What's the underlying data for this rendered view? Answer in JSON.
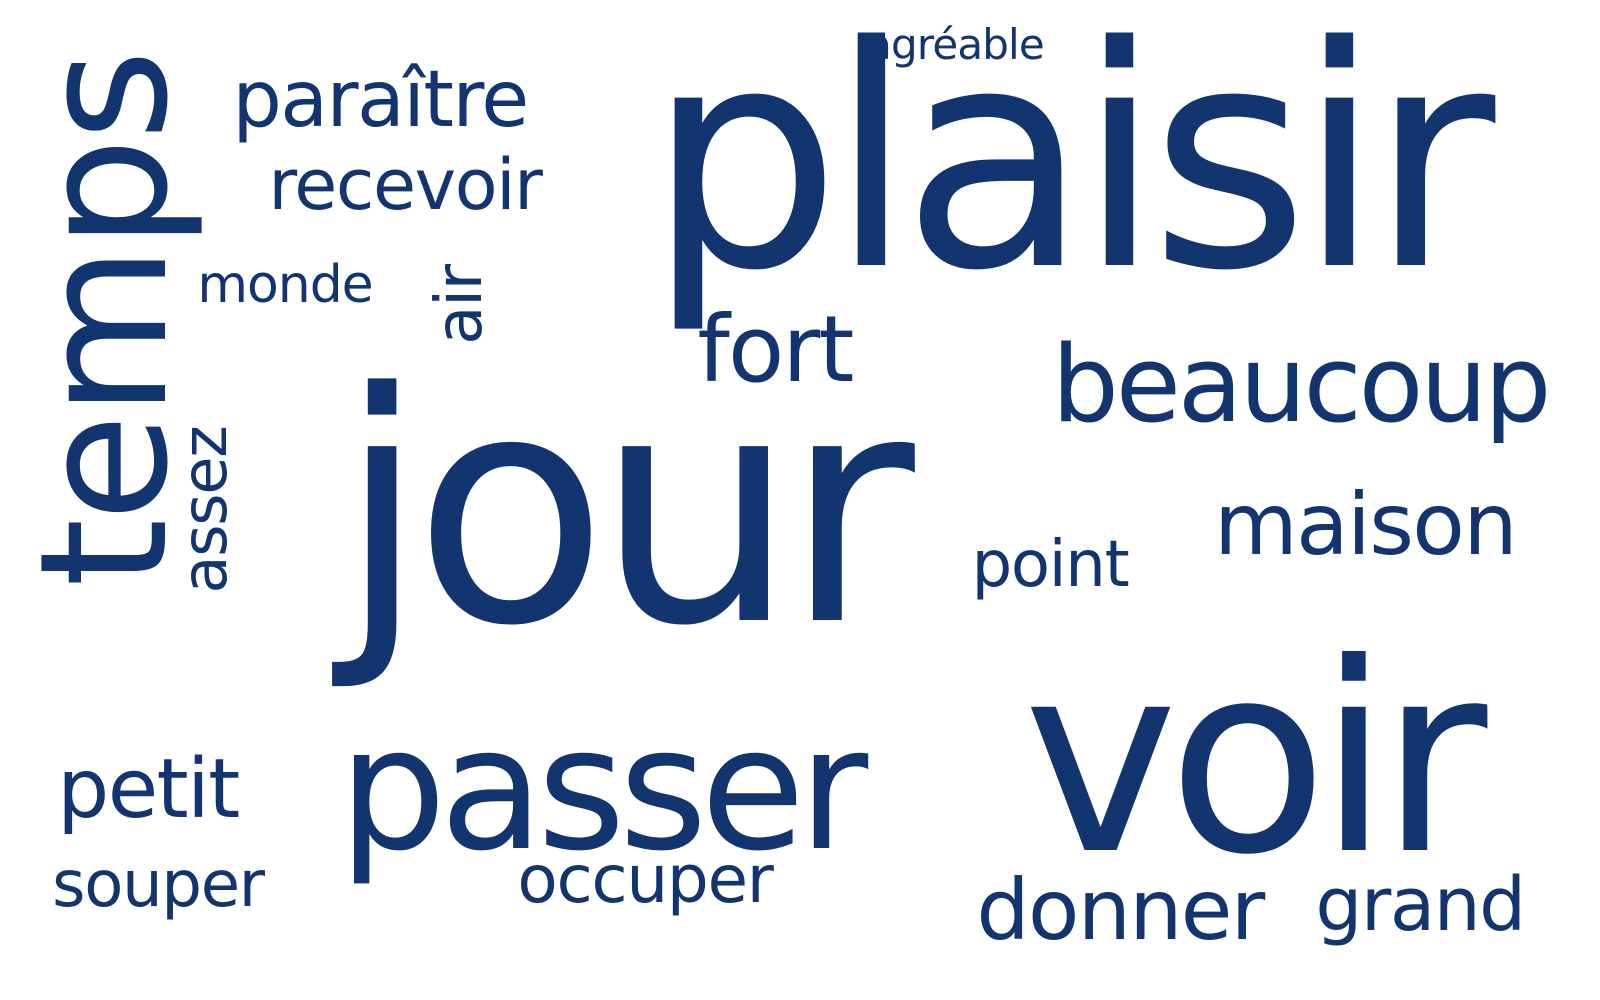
{
  "color": "#13356f",
  "background": "#ffffff",
  "words": {
    "plaisir": "plaisir",
    "jour": "jour",
    "voir": "voir",
    "passer": "passer",
    "temps": "temps",
    "beaucoup": "beaucoup",
    "maison": "maison",
    "fort": "fort",
    "paraitre": "paraître",
    "recevoir": "recevoir",
    "monde": "monde",
    "agreable": "agréable",
    "air": "air",
    "assez": "assez",
    "point": "point",
    "petit": "petit",
    "souper": "souper",
    "occuper": "occuper",
    "donner": "donner",
    "grand": "grand"
  }
}
